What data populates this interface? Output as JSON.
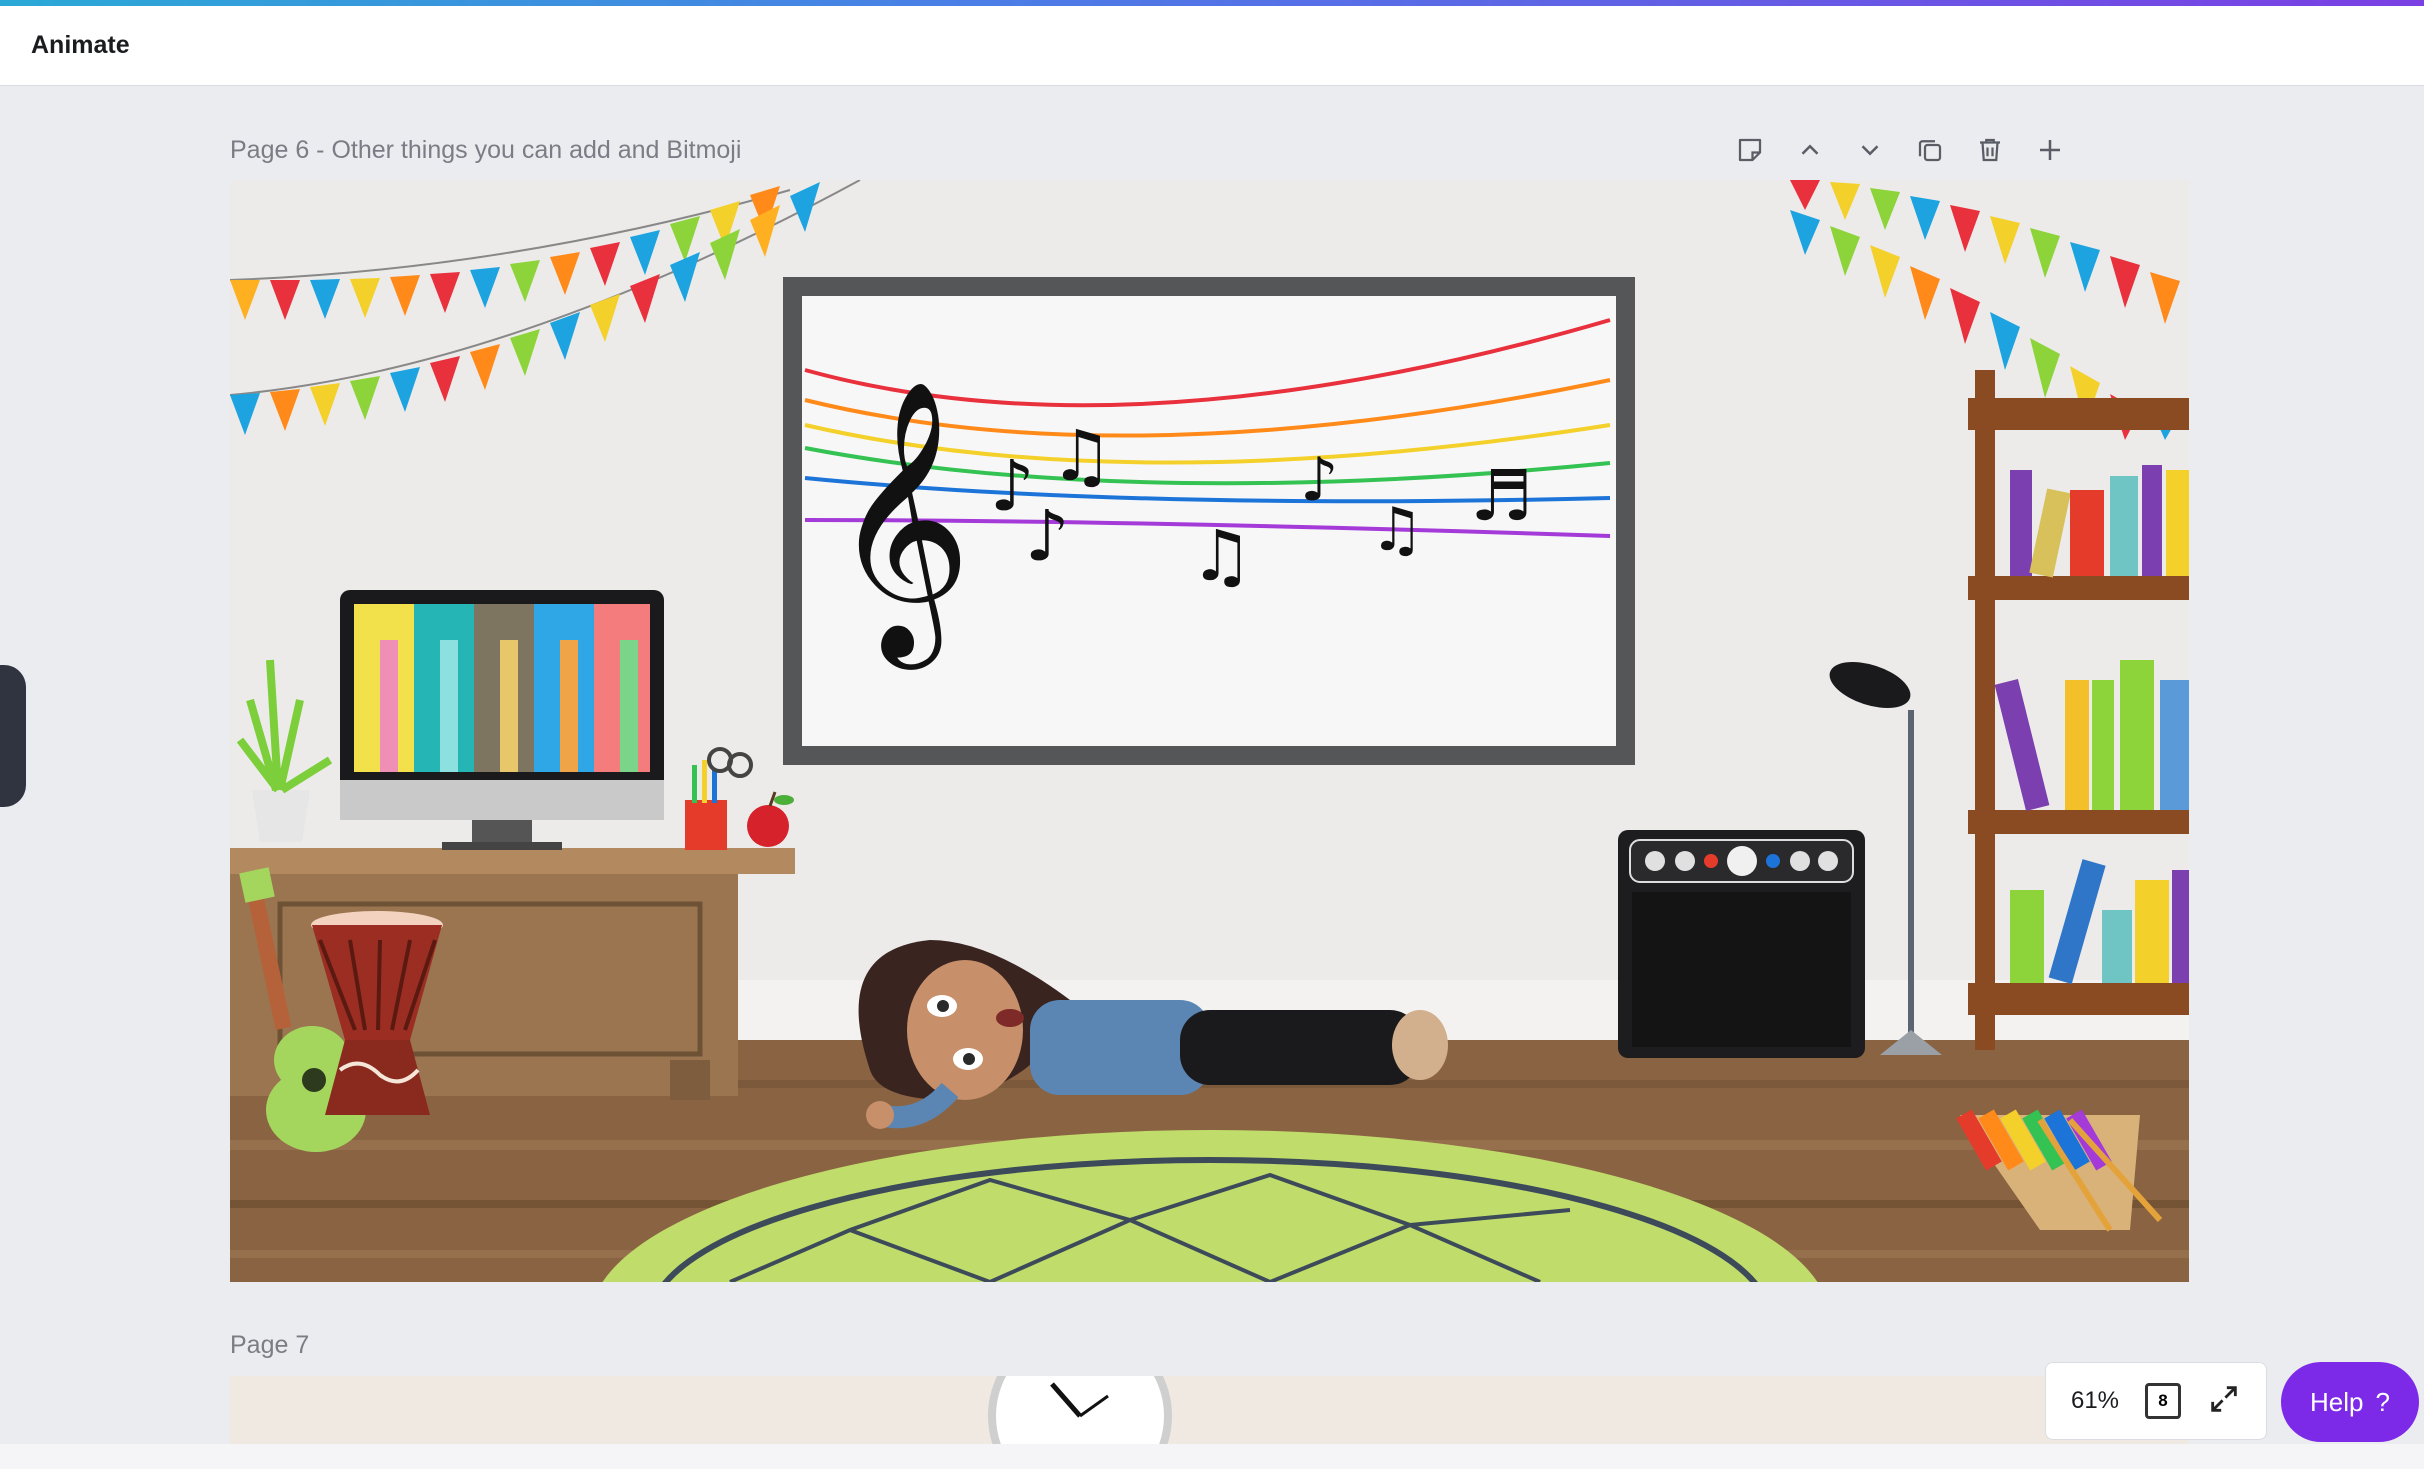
{
  "topbar": {
    "title": "Animate"
  },
  "pages": [
    {
      "label": "Page 6 - Other things you can add and Bitmoji"
    },
    {
      "label": "Page 7"
    }
  ],
  "page_actions": [
    "note-icon",
    "chevron-up-icon",
    "chevron-down-icon",
    "duplicate-icon",
    "trash-icon",
    "plus-icon"
  ],
  "zoom": {
    "level": "61%",
    "page_count": "8"
  },
  "help": {
    "label": "Help",
    "icon": "?"
  },
  "colors": {
    "accent": "#7d2ae8",
    "topbar_gradient_start": "#2aa9d6",
    "topbar_gradient_end": "#7b3fe4"
  }
}
